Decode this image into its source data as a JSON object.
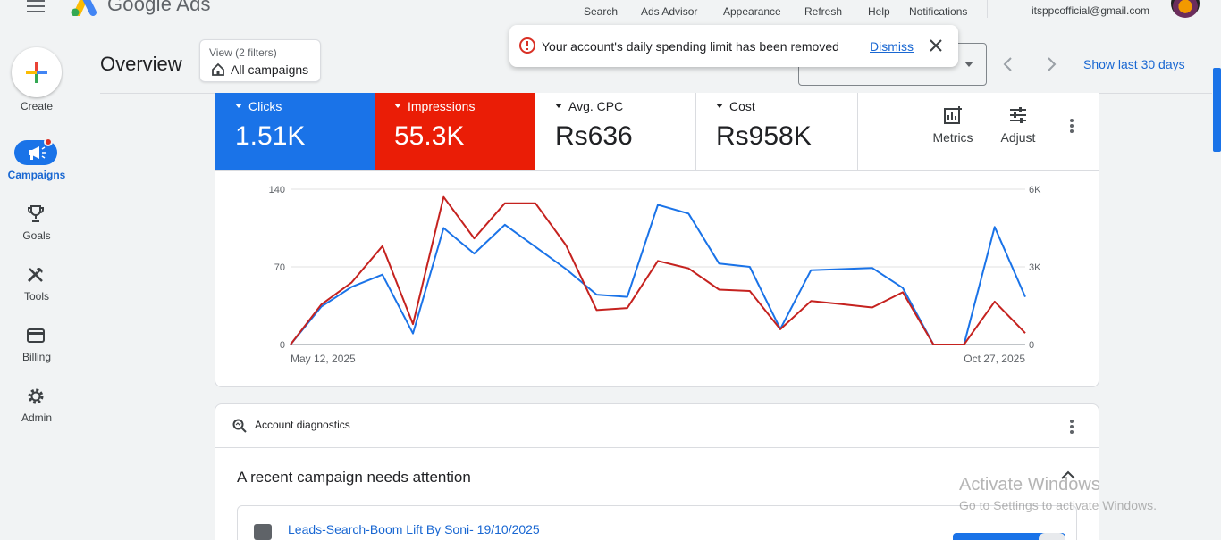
{
  "app": {
    "brand": "Google Ads",
    "account_email": "itsppcofficial@gmail.com"
  },
  "topnav": [
    "Search",
    "Ads Advisor",
    "Appearance",
    "Refresh",
    "Help",
    "Notifications"
  ],
  "rail": {
    "create": "Create",
    "campaigns": "Campaigns",
    "goals": "Goals",
    "tools": "Tools",
    "billing": "Billing",
    "admin": "Admin"
  },
  "overview": {
    "title": "Overview",
    "view_filters": "View (2 filters)",
    "view_value": "All campaigns",
    "show_last": "Show last 30 days"
  },
  "toast": {
    "message": "Your account's daily spending limit has been removed",
    "dismiss": "Dismiss"
  },
  "metrics": {
    "clicks_label": "Clicks",
    "clicks_value": "1.51K",
    "impressions_label": "Impressions",
    "impressions_value": "55.3K",
    "cpc_label": "Avg. CPC",
    "cpc_value": "Rs636",
    "cost_label": "Cost",
    "cost_value": "Rs958K",
    "metrics_btn": "Metrics",
    "adjust_btn": "Adjust"
  },
  "colors": {
    "clicks": "#1a73e8",
    "impressions": "#ea1d06",
    "clicks_line": "#1a73e8",
    "impressions_line": "#c5221f"
  },
  "chart_data": {
    "type": "line",
    "x": [
      "May 12, 2025",
      "Oct 27, 2025"
    ],
    "x_start_label": "May 12, 2025",
    "x_end_label": "Oct 27, 2025",
    "left_ticks": [
      "140",
      "70",
      "0"
    ],
    "right_ticks": [
      "6K",
      "3K",
      "0"
    ],
    "ylim_left": [
      0,
      140
    ],
    "ylim_right": [
      0,
      6000
    ],
    "grid": true,
    "series": [
      {
        "name": "Clicks",
        "axis": "left",
        "values": [
          0,
          34,
          52,
          63,
          10,
          105,
          82,
          108,
          88,
          68,
          45,
          43,
          126,
          118,
          73,
          70,
          14,
          67,
          68,
          69,
          51,
          0,
          0,
          106,
          43
        ]
      },
      {
        "name": "Impressions",
        "axis": "right",
        "values": [
          0,
          1540,
          2400,
          3800,
          790,
          5700,
          4100,
          5460,
          5460,
          3830,
          1330,
          1410,
          3230,
          2940,
          2120,
          2070,
          590,
          1680,
          1560,
          1430,
          2020,
          0,
          0,
          1660,
          440
        ]
      }
    ]
  },
  "diagnostics": {
    "header": "Account diagnostics",
    "title": "A recent campaign needs attention",
    "campaign_name": "Leads-Search-Boom Lift By Soni- 19/10/2025"
  },
  "watermark": {
    "line1": "Activate Windows",
    "line2": "Go to Settings to activate Windows."
  }
}
